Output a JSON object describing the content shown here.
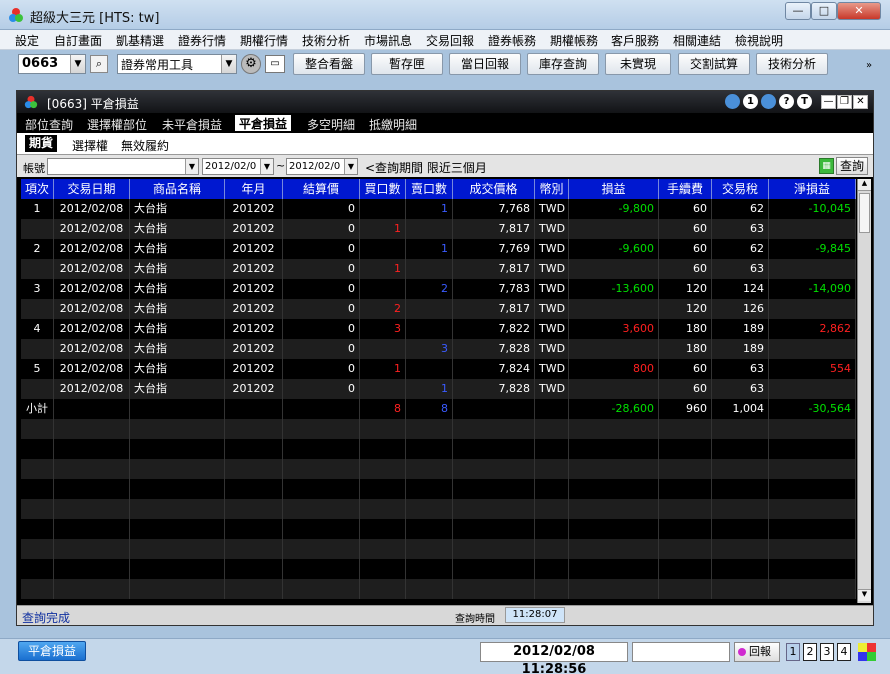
{
  "app": {
    "title": "超級大三元 [HTS: tw]",
    "window_buttons": {
      "minimize": "—",
      "maximize": "□",
      "close": "✕"
    }
  },
  "menu": [
    "設定",
    "自訂畫面",
    "凱基精選",
    "證券行情",
    "期權行情",
    "技術分析",
    "市場訊息",
    "交易回報",
    "證券帳務",
    "期權帳務",
    "客戶服務",
    "相關連結",
    "檢視說明"
  ],
  "toolbar": {
    "code": "0663",
    "tool_select": "證券常用工具",
    "buttons": [
      "整合看盤",
      "暫存匣",
      "當日回報",
      "庫存查詢",
      "未實現",
      "交割試算",
      "技術分析"
    ]
  },
  "inner": {
    "title": "[0663] 平倉損益",
    "circle_buttons": [
      "1",
      "?",
      "T"
    ]
  },
  "tabs1": [
    "部位查詢",
    "選擇權部位",
    "未平倉損益",
    "平倉損益",
    "多空明細",
    "抵繳明細"
  ],
  "tabs2": [
    "期貨",
    "選擇權",
    "無效履約"
  ],
  "filter": {
    "account_label": "帳號",
    "date_from": "2012/02/0",
    "date_to": "2012/02/0",
    "tilde": "~",
    "note": "<查詢期間 限近三個月",
    "query_button": "查詢"
  },
  "columns": [
    "項次",
    "交易日期",
    "商品名稱",
    "年月",
    "結算價",
    "買口數",
    "賣口數",
    "成交價格",
    "幣別",
    "損益",
    "手續費",
    "交易稅",
    "淨損益"
  ],
  "rows": [
    {
      "no": "1",
      "date": "2012/02/08",
      "name": "大台指",
      "ym": "201202",
      "settle": "0",
      "buy": "",
      "sell": "1",
      "price": "7,768",
      "cur": "TWD",
      "pl": "-9,800",
      "fee": "60",
      "tax": "62",
      "net": "-10,045"
    },
    {
      "no": "",
      "date": "2012/02/08",
      "name": "大台指",
      "ym": "201202",
      "settle": "0",
      "buy": "1",
      "sell": "",
      "price": "7,817",
      "cur": "TWD",
      "pl": "",
      "fee": "60",
      "tax": "63",
      "net": ""
    },
    {
      "no": "2",
      "date": "2012/02/08",
      "name": "大台指",
      "ym": "201202",
      "settle": "0",
      "buy": "",
      "sell": "1",
      "price": "7,769",
      "cur": "TWD",
      "pl": "-9,600",
      "fee": "60",
      "tax": "62",
      "net": "-9,845"
    },
    {
      "no": "",
      "date": "2012/02/08",
      "name": "大台指",
      "ym": "201202",
      "settle": "0",
      "buy": "1",
      "sell": "",
      "price": "7,817",
      "cur": "TWD",
      "pl": "",
      "fee": "60",
      "tax": "63",
      "net": ""
    },
    {
      "no": "3",
      "date": "2012/02/08",
      "name": "大台指",
      "ym": "201202",
      "settle": "0",
      "buy": "",
      "sell": "2",
      "price": "7,783",
      "cur": "TWD",
      "pl": "-13,600",
      "fee": "120",
      "tax": "124",
      "net": "-14,090"
    },
    {
      "no": "",
      "date": "2012/02/08",
      "name": "大台指",
      "ym": "201202",
      "settle": "0",
      "buy": "2",
      "sell": "",
      "price": "7,817",
      "cur": "TWD",
      "pl": "",
      "fee": "120",
      "tax": "126",
      "net": ""
    },
    {
      "no": "4",
      "date": "2012/02/08",
      "name": "大台指",
      "ym": "201202",
      "settle": "0",
      "buy": "3",
      "sell": "",
      "price": "7,822",
      "cur": "TWD",
      "pl": "3,600",
      "fee": "180",
      "tax": "189",
      "net": "2,862"
    },
    {
      "no": "",
      "date": "2012/02/08",
      "name": "大台指",
      "ym": "201202",
      "settle": "0",
      "buy": "",
      "sell": "3",
      "price": "7,828",
      "cur": "TWD",
      "pl": "",
      "fee": "180",
      "tax": "189",
      "net": ""
    },
    {
      "no": "5",
      "date": "2012/02/08",
      "name": "大台指",
      "ym": "201202",
      "settle": "0",
      "buy": "1",
      "sell": "",
      "price": "7,824",
      "cur": "TWD",
      "pl": "800",
      "fee": "60",
      "tax": "63",
      "net": "554"
    },
    {
      "no": "",
      "date": "2012/02/08",
      "name": "大台指",
      "ym": "201202",
      "settle": "0",
      "buy": "",
      "sell": "1",
      "price": "7,828",
      "cur": "TWD",
      "pl": "",
      "fee": "60",
      "tax": "63",
      "net": ""
    }
  ],
  "subtotal": {
    "label": "小計",
    "buy": "8",
    "sell": "8",
    "pl": "-28,600",
    "fee": "960",
    "tax": "1,004",
    "net": "-30,564"
  },
  "status": {
    "message": "查詢完成",
    "time_label": "查詢時間",
    "time": "11:28:07"
  },
  "bottom": {
    "task": "平倉損益",
    "clock": "2012/02/08 11:28:56",
    "report": "回報",
    "pages": [
      "1",
      "2",
      "3",
      "4"
    ]
  },
  "colors": {
    "header": "#0018d0",
    "positive": "#ff2020",
    "negative": "#00e000",
    "buy": "#ff2020",
    "sell": "#3a5bff"
  }
}
